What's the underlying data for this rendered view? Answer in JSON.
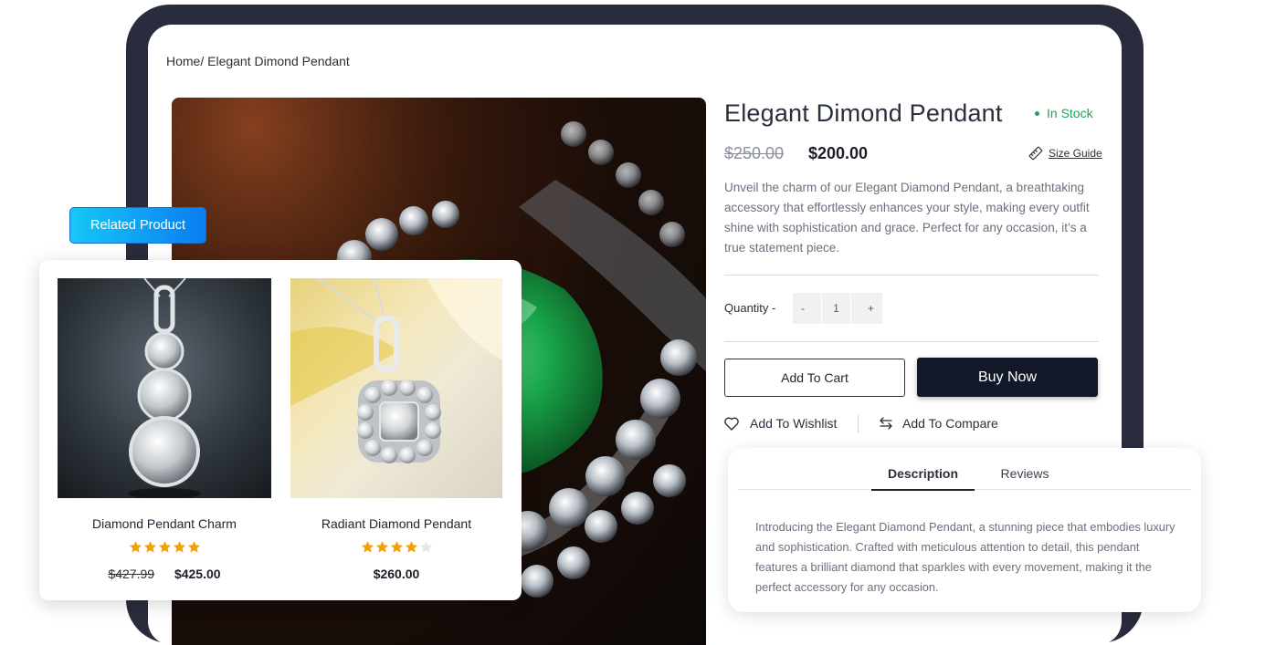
{
  "breadcrumb": "Home/ Elegant Dimond  Pendant",
  "product": {
    "title": "Elegant Dimond Pendant",
    "stock": "In Stock",
    "price_old": "$250.00",
    "price_new": "$200.00",
    "size_guide": "Size Guide",
    "description": "Unveil the charm of our Elegant Diamond Pendant, a breathtaking accessory that effortlessly enhances your style, making every outfit shine with sophistication and grace. Perfect for any occasion, it’s a true statement piece.",
    "quantity_label": "Quantity -",
    "quantity_minus": "-",
    "quantity_value": "1",
    "quantity_plus": "+",
    "add_to_cart": "Add To Cart",
    "buy_now": "Buy Now",
    "add_to_wishlist": "Add To Wishlist",
    "add_to_compare": "Add To Compare"
  },
  "tabs": {
    "items": [
      "Description",
      "Reviews"
    ],
    "active": "Description",
    "content": "Introducing the Elegant Diamond Pendant, a stunning piece that embodies luxury and sophistication. Crafted with meticulous attention to detail, this pendant features a brilliant diamond that sparkles with every movement, making it the perfect accessory for any occasion."
  },
  "related": {
    "tag": "Related Product",
    "items": [
      {
        "name": "Diamond Pendant Charm",
        "rating": 5,
        "price_old": "$427.99",
        "price_new": "$425.00"
      },
      {
        "name": "Radiant Diamond Pendant",
        "rating": 4,
        "price_old": "",
        "price_new": "$260.00"
      }
    ]
  },
  "colors": {
    "frame": "#282c3d",
    "in_stock": "#22a05a",
    "buy_button": "#121828",
    "star": "#f5a000",
    "tag_gradient_start": "#16c8f6",
    "tag_gradient_end": "#0a7cf0"
  },
  "icons": [
    "ruler-icon",
    "heart-icon",
    "compare-arrows-icon",
    "star-icon"
  ]
}
